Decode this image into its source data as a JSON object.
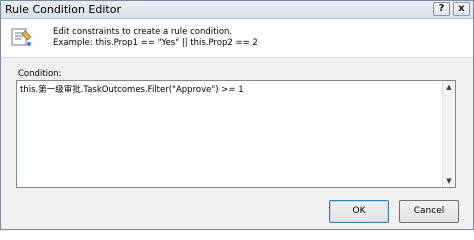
{
  "window": {
    "title": "Rule Condition Editor"
  },
  "titlebar": {
    "help_glyph": "?",
    "close_glyph": "x"
  },
  "header": {
    "icon": "rule-editor-icon",
    "line1": "Edit constraints to create a rule condition.",
    "line2": "Example: this.Prop1 == \"Yes\" || this.Prop2 == 2"
  },
  "condition": {
    "label": "Condition:",
    "value": "this.第一级审批.TaskOutcomes.Filter(\"Approve\") >= 1"
  },
  "buttons": {
    "ok": "OK",
    "cancel": "Cancel"
  }
}
